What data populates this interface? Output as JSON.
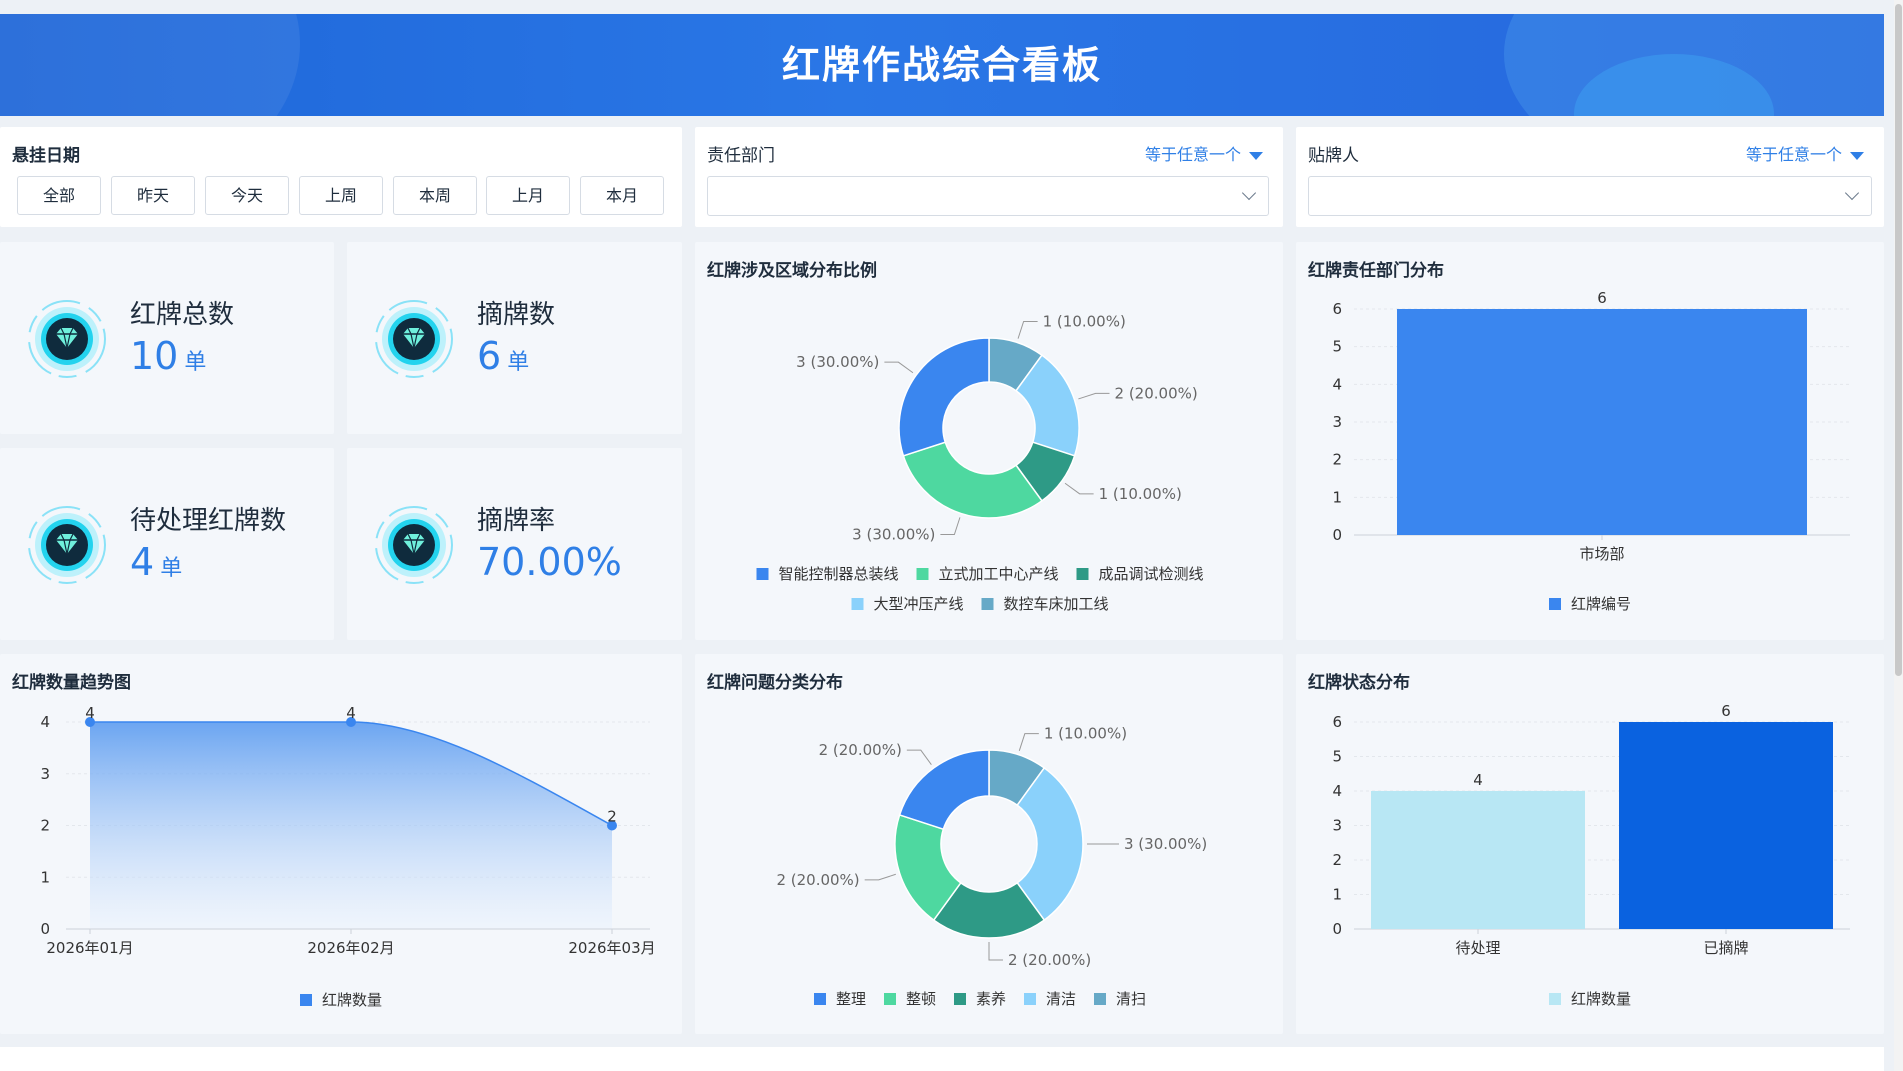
{
  "header": {
    "title": "红牌作战综合看板"
  },
  "filters": {
    "date": {
      "label": "悬挂日期",
      "buttons": [
        "全部",
        "昨天",
        "今天",
        "上周",
        "本周",
        "上月",
        "本月"
      ]
    },
    "department": {
      "label": "责任部门",
      "mode": "等于任意一个",
      "value": ""
    },
    "poster": {
      "label": "贴牌人",
      "mode": "等于任意一个",
      "value": ""
    }
  },
  "kpis": [
    {
      "label": "红牌总数",
      "value": "10",
      "unit": "单"
    },
    {
      "label": "摘牌数",
      "value": "6",
      "unit": "单"
    },
    {
      "label": "待处理红牌数",
      "value": "4",
      "unit": "单"
    },
    {
      "label": "摘牌率",
      "value": "70.00%",
      "unit": ""
    }
  ],
  "colors": {
    "accent": "#2f7fe6",
    "blue": "#3a86ef",
    "green": "#4ed8a0",
    "teal": "#2e9a86",
    "lightblue": "#8ad1fb",
    "steel": "#66a9c7",
    "pale": "#b8e7f4",
    "deep": "#0a62e0"
  },
  "chart_data": [
    {
      "id": "region",
      "type": "pie",
      "title": "红牌涉及区域分布比例",
      "slices": [
        {
          "name": "数控车床加工线",
          "value": 1,
          "label": "1 (10.00%)"
        },
        {
          "name": "大型冲压产线",
          "value": 2,
          "label": "2 (20.00%)"
        },
        {
          "name": "成品调试检测线",
          "value": 1,
          "label": "1 (10.00%)"
        },
        {
          "name": "立式加工中心产线",
          "value": 3,
          "label": "3 (30.00%)"
        },
        {
          "name": "智能控制器总装线",
          "value": 3,
          "label": "3 (30.00%)"
        }
      ],
      "legend": [
        "智能控制器总装线",
        "立式加工中心产线",
        "成品调试检测线",
        "大型冲压产线",
        "数控车床加工线"
      ]
    },
    {
      "id": "dept",
      "type": "bar",
      "title": "红牌责任部门分布",
      "categories": [
        "市场部"
      ],
      "series": [
        {
          "name": "红牌编号",
          "values": [
            6
          ]
        }
      ],
      "ylim": [
        0,
        6
      ],
      "yticks": [
        0,
        1,
        2,
        3,
        4,
        5,
        6
      ]
    },
    {
      "id": "trend",
      "type": "area",
      "title": "红牌数量趋势图",
      "categories": [
        "2026年01月",
        "2026年02月",
        "2026年03月"
      ],
      "series": [
        {
          "name": "红牌数量",
          "values": [
            4,
            4,
            2
          ]
        }
      ],
      "ylim": [
        0,
        4
      ],
      "yticks": [
        0,
        1,
        2,
        3,
        4
      ]
    },
    {
      "id": "issue",
      "type": "pie",
      "title": "红牌问题分类分布",
      "slices": [
        {
          "name": "清扫",
          "value": 1,
          "label": "1 (10.00%)"
        },
        {
          "name": "清洁",
          "value": 3,
          "label": "3 (30.00%)"
        },
        {
          "name": "素养",
          "value": 2,
          "label": "2 (20.00%)"
        },
        {
          "name": "整顿",
          "value": 2,
          "label": "2 (20.00%)"
        },
        {
          "name": "整理",
          "value": 2,
          "label": "2 (20.00%)"
        }
      ],
      "legend": [
        "整理",
        "整顿",
        "素养",
        "清洁",
        "清扫"
      ]
    },
    {
      "id": "status",
      "type": "bar",
      "title": "红牌状态分布",
      "categories": [
        "待处理",
        "已摘牌"
      ],
      "series": [
        {
          "name": "红牌数量",
          "values": [
            4,
            6
          ]
        }
      ],
      "ylim": [
        0,
        6
      ],
      "yticks": [
        0,
        1,
        2,
        3,
        4,
        5,
        6
      ]
    }
  ]
}
